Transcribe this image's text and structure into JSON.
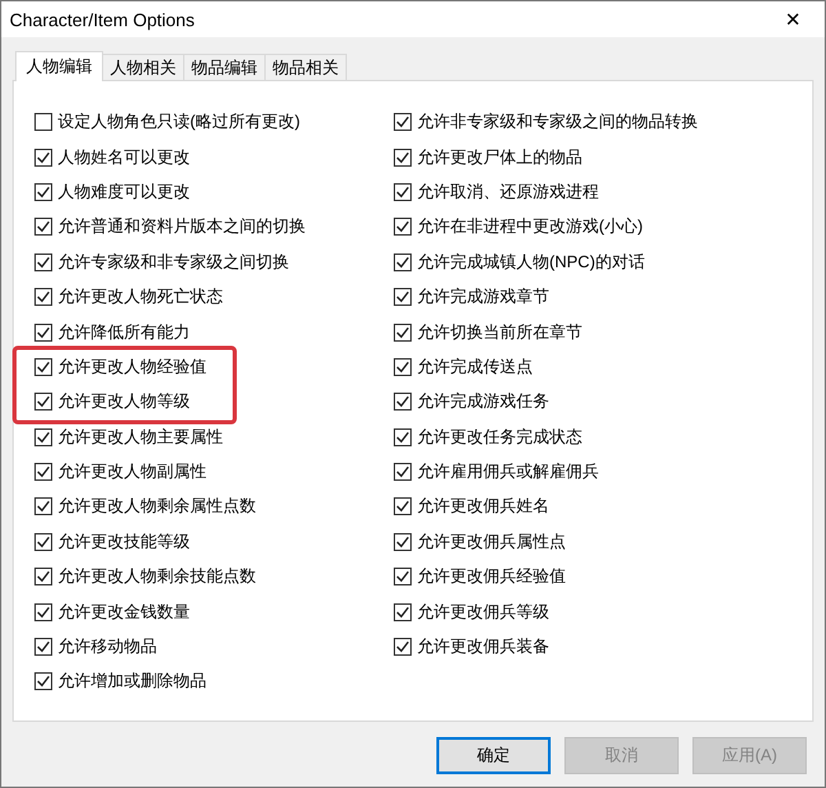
{
  "window": {
    "title": "Character/Item Options",
    "close": "✕"
  },
  "tabs": [
    {
      "label": "人物编辑",
      "selected": true
    },
    {
      "label": "人物相关",
      "selected": false
    },
    {
      "label": "物品编辑",
      "selected": false
    },
    {
      "label": "物品相关",
      "selected": false
    }
  ],
  "options_left": [
    {
      "label": "设定人物角色只读(略过所有更改)",
      "checked": false,
      "highlighted": false
    },
    {
      "label": "人物姓名可以更改",
      "checked": true,
      "highlighted": false
    },
    {
      "label": "人物难度可以更改",
      "checked": true,
      "highlighted": false
    },
    {
      "label": "允许普通和资料片版本之间的切换",
      "checked": true,
      "highlighted": false
    },
    {
      "label": "允许专家级和非专家级之间切换",
      "checked": true,
      "highlighted": false
    },
    {
      "label": "允许更改人物死亡状态",
      "checked": true,
      "highlighted": false
    },
    {
      "label": "允许降低所有能力",
      "checked": true,
      "highlighted": false
    },
    {
      "label": "允许更改人物经验值",
      "checked": true,
      "highlighted": true
    },
    {
      "label": "允许更改人物等级",
      "checked": true,
      "highlighted": true
    },
    {
      "label": "允许更改人物主要属性",
      "checked": true,
      "highlighted": false
    },
    {
      "label": "允许更改人物副属性",
      "checked": true,
      "highlighted": false
    },
    {
      "label": "允许更改人物剩余属性点数",
      "checked": true,
      "highlighted": false
    },
    {
      "label": "允许更改技能等级",
      "checked": true,
      "highlighted": false
    },
    {
      "label": "允许更改人物剩余技能点数",
      "checked": true,
      "highlighted": false
    },
    {
      "label": "允许更改金钱数量",
      "checked": true,
      "highlighted": false
    },
    {
      "label": "允许移动物品",
      "checked": true,
      "highlighted": false
    },
    {
      "label": "允许增加或删除物品",
      "checked": true,
      "highlighted": false
    }
  ],
  "options_right": [
    {
      "label": "允许非专家级和专家级之间的物品转换",
      "checked": true,
      "highlighted": false
    },
    {
      "label": "允许更改尸体上的物品",
      "checked": true,
      "highlighted": false
    },
    {
      "label": "允许取消、还原游戏进程",
      "checked": true,
      "highlighted": false
    },
    {
      "label": "允许在非进程中更改游戏(小心)",
      "checked": true,
      "highlighted": false
    },
    {
      "label": "允许完成城镇人物(NPC)的对话",
      "checked": true,
      "highlighted": false
    },
    {
      "label": "允许完成游戏章节",
      "checked": true,
      "highlighted": false
    },
    {
      "label": "允许切换当前所在章节",
      "checked": true,
      "highlighted": false
    },
    {
      "label": "允许完成传送点",
      "checked": true,
      "highlighted": false
    },
    {
      "label": "允许完成游戏任务",
      "checked": true,
      "highlighted": false
    },
    {
      "label": "允许更改任务完成状态",
      "checked": true,
      "highlighted": false
    },
    {
      "label": "允许雇用佣兵或解雇佣兵",
      "checked": true,
      "highlighted": false
    },
    {
      "label": "允许更改佣兵姓名",
      "checked": true,
      "highlighted": false
    },
    {
      "label": "允许更改佣兵属性点",
      "checked": true,
      "highlighted": false
    },
    {
      "label": "允许更改佣兵经验值",
      "checked": true,
      "highlighted": false
    },
    {
      "label": "允许更改佣兵等级",
      "checked": true,
      "highlighted": false
    },
    {
      "label": "允许更改佣兵装备",
      "checked": true,
      "highlighted": false
    }
  ],
  "buttons": [
    {
      "label": "确定",
      "default": true,
      "disabled": false
    },
    {
      "label": "取消",
      "default": false,
      "disabled": true
    },
    {
      "label": "应用(A)",
      "default": false,
      "disabled": true
    }
  ]
}
